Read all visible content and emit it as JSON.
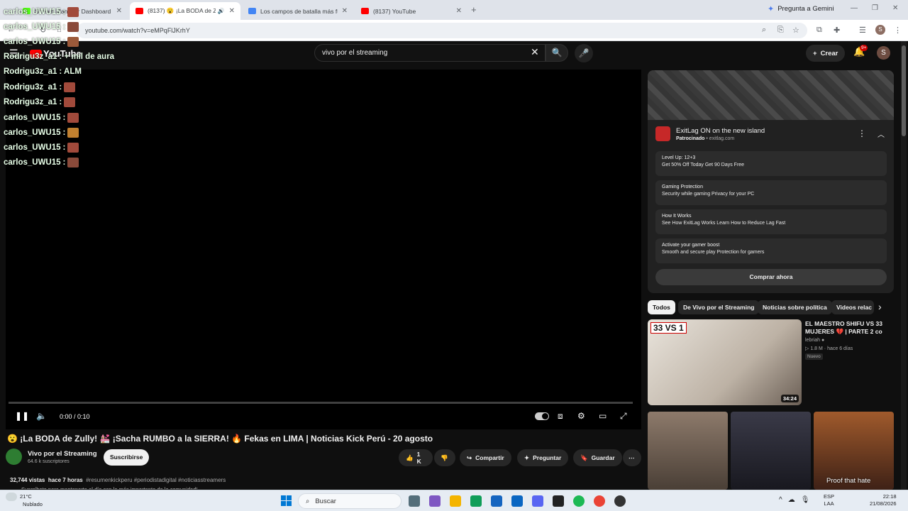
{
  "browser": {
    "tabs": [
      {
        "label": "Stream Manager Dashboard",
        "icon": "kick-icon",
        "color": "#53fc18",
        "active": false
      },
      {
        "label": "(8137) 😮 ¡La BODA de Zully",
        "icon": "youtube-icon",
        "color": "#ff0000",
        "active": true
      },
      {
        "label": "Los campos de batalla más fue",
        "icon": "doc-icon",
        "color": "#4285f4",
        "active": false
      },
      {
        "label": "(8137) YouTube",
        "icon": "youtube-icon",
        "color": "#ff0000",
        "active": false
      }
    ],
    "new_tab": "+",
    "gemini_label": "Pregunta a Gemini",
    "url": "youtube.com/watch?v=eMPqFlJKrhY",
    "profile_initial": "S"
  },
  "chat": {
    "messages": [
      {
        "user": "carlos_UWU15",
        "text": ":",
        "emote": true
      },
      {
        "user": "carlos_UWU15",
        "text": ":",
        "emote": true
      },
      {
        "user": "carlos_UWU15",
        "text": ":",
        "emote": true
      },
      {
        "user": "Rodrigu3z_a1",
        "text": ": + mil de aura",
        "emote": false
      },
      {
        "user": "Rodrigu3z_a1",
        "text": ": ALM",
        "emote": false
      },
      {
        "user": "Rodrigu3z_a1",
        "text": ":",
        "emote": true
      },
      {
        "user": "Rodrigu3z_a1",
        "text": ":",
        "emote": true
      },
      {
        "user": "carlos_UWU15",
        "text": ":",
        "emote": true
      },
      {
        "user": "carlos_UWU15",
        "text": ":",
        "emote": true
      },
      {
        "user": "carlos_UWU15",
        "text": ":",
        "emote": true
      },
      {
        "user": "carlos_UWU15",
        "text": ":",
        "emote": true
      }
    ]
  },
  "youtube": {
    "logo": "YouTube",
    "logo_sup": "PE",
    "search_value": "vivo por el streaming",
    "create_label": "Crear",
    "notifications_badge": "9+",
    "avatar_initial": "S",
    "player": {
      "time": "0:00 / 0:10",
      "progress_fraction": 0.0
    },
    "video": {
      "title": "😮 ¡La BODA de Zully! 💒 ¡Sacha RUMBO a la SIERRA! 🔥 Fekas en LIMA | Noticias Kick Perú - 20 agosto",
      "channel": "Vivo por el Streaming",
      "subscribers": "64.6 k suscriptores",
      "subscribe_label": "Suscribirse",
      "likes": "1 K",
      "share_label": "Compartir",
      "ask_label": "Preguntar",
      "save_label": "Guardar",
      "views": "32,744 vistas",
      "age": "hace 7 horas",
      "tags": "#resumenkickperu #periodistadigital #noticiasstreamers",
      "desc_partial": "Suscríbete para mantenerte al día con lo más importante de la comunidad!"
    },
    "ad": {
      "title": "ExitLag ON on the new island",
      "sponsored": "Patrocinado",
      "domain": "exitlag.com",
      "rows": [
        {
          "heading": "Level Up: 12+3",
          "sub": "Get 50% Off Today Get 90 Days Free"
        },
        {
          "heading": "Gaming Protection",
          "sub": "Security while gaming Privacy for your PC"
        },
        {
          "heading": "How It Works",
          "sub": "See How ExitLag Works Learn How to Reduce Lag Fast"
        },
        {
          "heading": "Activate your gamer boost",
          "sub": "Smooth and secure play Protection for gamers"
        }
      ],
      "cta": "Comprar ahora"
    },
    "chips": [
      "Todos",
      "De Vivo por el Streaming",
      "Noticias sobre política",
      "Videos relac"
    ],
    "recommendation": {
      "title": "EL MAESTRO SHIFU VS 33 MUJERES 💔 | PARTE 2 co",
      "channel": "lebriah",
      "views": "1.8 M",
      "age": "hace 6 días",
      "badge": "Nuevo",
      "duration": "34:24",
      "thumb_text": "33 VS 1"
    },
    "shorts_caption": "Proof that hate"
  },
  "taskbar": {
    "temp": "21°C",
    "weather": "Nublado",
    "search": "Buscar",
    "lang_top": "ESP",
    "lang_bottom": "LAA",
    "time": "22:18",
    "date": "21/08/2026"
  }
}
